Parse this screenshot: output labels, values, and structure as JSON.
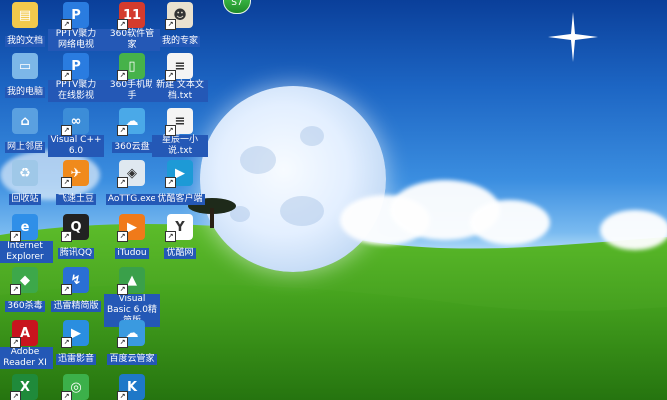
{
  "desktop": {
    "tray_badge": "S7",
    "icons": [
      {
        "label": "我的文档",
        "color": "#f2c94c",
        "glyph": "▤",
        "col": 0,
        "row": 0
      },
      {
        "label": "PPTV聚力 网络电视",
        "color": "#2a7ce0",
        "glyph": "P",
        "col": 1,
        "row": 0
      },
      {
        "label": "360软件管家",
        "color": "#d43b2d",
        "glyph": "11",
        "col": 2,
        "row": 0
      },
      {
        "label": "我的专家",
        "color": "#e9e1cf",
        "glyph": "☻",
        "col": 3,
        "row": 0
      },
      {
        "label": "我的电脑",
        "color": "#7cb7e8",
        "glyph": "▭",
        "col": 0,
        "row": 1
      },
      {
        "label": "PPTV聚力 在线影视",
        "color": "#2a7ce0",
        "glyph": "P",
        "col": 1,
        "row": 1
      },
      {
        "label": "360手机助手",
        "color": "#46b24a",
        "glyph": "▯",
        "col": 2,
        "row": 1
      },
      {
        "label": "新建 文本文档.txt",
        "color": "#f4f4f4",
        "glyph": "≡",
        "col": 3,
        "row": 1
      },
      {
        "label": "网上邻居",
        "color": "#5aa0e0",
        "glyph": "⌂",
        "col": 0,
        "row": 2
      },
      {
        "label": "Visual C++ 6.0",
        "color": "#3c8dd8",
        "glyph": "∞",
        "col": 1,
        "row": 2
      },
      {
        "label": "360云盘",
        "color": "#4aa9e8",
        "glyph": "☁",
        "col": 2,
        "row": 2
      },
      {
        "label": "星辰一小说.txt",
        "color": "#f4f4f4",
        "glyph": "≡",
        "col": 3,
        "row": 2
      },
      {
        "label": "回收站",
        "color": "#9fc8e8",
        "glyph": "♻",
        "col": 0,
        "row": 3
      },
      {
        "label": "飞速土豆",
        "color": "#f08a1c",
        "glyph": "✈",
        "col": 1,
        "row": 3
      },
      {
        "label": "AoTTG.exe",
        "color": "#dfe8f0",
        "glyph": "◈",
        "col": 2,
        "row": 3
      },
      {
        "label": "优酷客户端",
        "color": "#1d9ad6",
        "glyph": "▶",
        "col": 3,
        "row": 3
      },
      {
        "label": "Internet Explorer",
        "color": "#2f8fe8",
        "glyph": "e",
        "col": 0,
        "row": 4
      },
      {
        "label": "腾讯QQ",
        "color": "#222222",
        "glyph": "Q",
        "col": 1,
        "row": 4
      },
      {
        "label": "iTudou",
        "color": "#f07a1a",
        "glyph": "▶",
        "col": 2,
        "row": 4
      },
      {
        "label": "优酷网",
        "color": "#ffffff",
        "glyph": "Y",
        "col": 3,
        "row": 4
      },
      {
        "label": "360杀毒",
        "color": "#3da84a",
        "glyph": "◆",
        "col": 0,
        "row": 5
      },
      {
        "label": "迅雷精简版",
        "color": "#2a6fd4",
        "glyph": "↯",
        "col": 1,
        "row": 5
      },
      {
        "label": "Visual Basic 6.0精简版",
        "color": "#3aa04a",
        "glyph": "▲",
        "col": 2,
        "row": 5
      },
      {
        "label": "Adobe Reader XI",
        "color": "#c8141e",
        "glyph": "A",
        "col": 0,
        "row": 6
      },
      {
        "label": "迅雷影音",
        "color": "#2a8ee0",
        "glyph": "▶",
        "col": 1,
        "row": 6
      },
      {
        "label": "百度云管家",
        "color": "#3a9ae0",
        "glyph": "☁",
        "col": 2,
        "row": 6
      },
      {
        "label": "",
        "color": "#1f8a3a",
        "glyph": "X",
        "col": 0,
        "row": 7
      },
      {
        "label": "",
        "color": "#3cb04a",
        "glyph": "◎",
        "col": 1,
        "row": 7
      },
      {
        "label": "",
        "color": "#1e78c8",
        "glyph": "K",
        "col": 2,
        "row": 7
      }
    ]
  }
}
